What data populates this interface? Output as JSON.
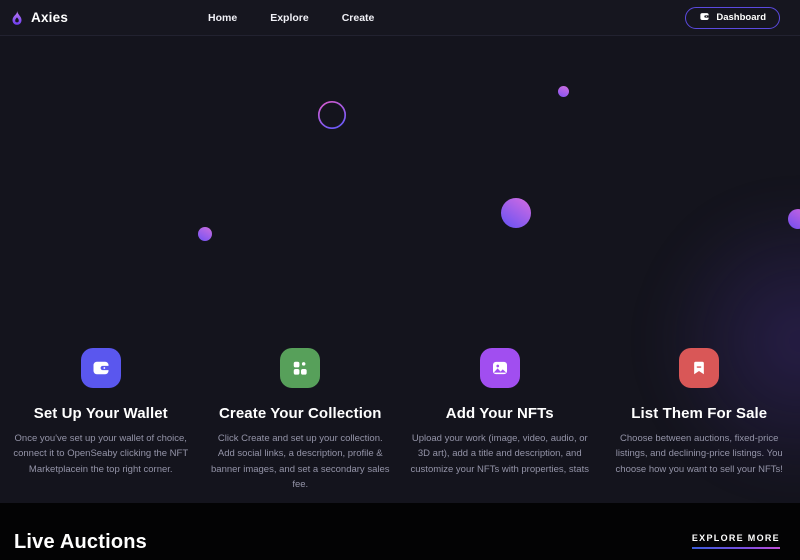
{
  "colors": {
    "header_bg": "#16161f",
    "hero_bg": "#14141d",
    "footer_bg": "#030304",
    "accent_border": "#5b4ae0",
    "muted_text": "#9494a8"
  },
  "header": {
    "brand": "Axies",
    "nav_items": [
      {
        "label": "Home"
      },
      {
        "label": "Explore"
      },
      {
        "label": "Create"
      }
    ],
    "dashboard_label": "Dashboard"
  },
  "features": [
    {
      "icon": "wallet-icon",
      "color": "#5a57ee",
      "title": "Set Up Your Wallet",
      "description": "Once you've set up your wallet of choice, connect it to OpenSeaby clicking the NFT Marketplacein the top right corner."
    },
    {
      "icon": "category-icon",
      "color": "#57a05a",
      "title": "Create Your Collection",
      "description": "Click Create and set up your collection. Add social links, a description, profile & banner images, and set a secondary sales fee."
    },
    {
      "icon": "image-icon",
      "color": "#a14ef0",
      "title": "Add Your NFTs",
      "description": "Upload your work (image, video, audio, or 3D art), add a title and description, and customize your NFTs with properties, stats"
    },
    {
      "icon": "bookmark-icon",
      "color": "#d95757",
      "title": "List Them For Sale",
      "description": "Choose between auctions, fixed-price listings, and declining-price listings. You choose how you want to sell your NFTs!"
    }
  ],
  "live_auctions": {
    "heading": "Live Auctions",
    "explore_more": "EXPLORE MORE"
  }
}
